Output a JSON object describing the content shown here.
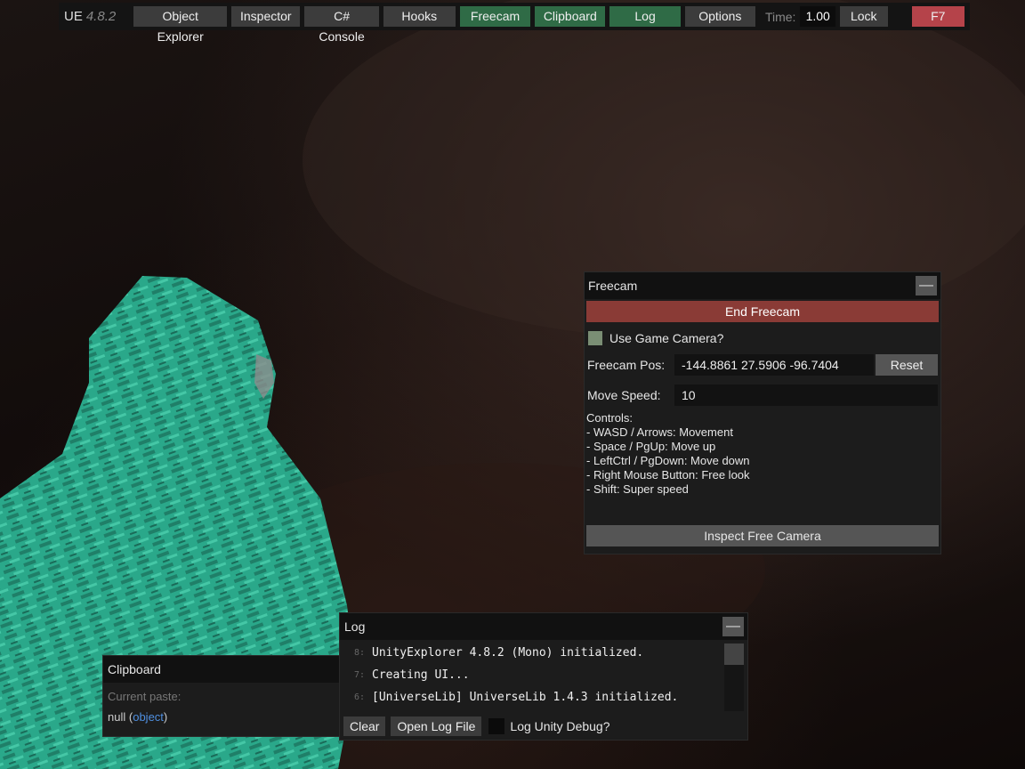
{
  "topbar": {
    "title": "UE",
    "version": "4.8.2",
    "buttons": [
      "Object Explorer",
      "Inspector",
      "C# Console",
      "Hooks",
      "Freecam",
      "Clipboard",
      "Log",
      "Options"
    ],
    "time_label": "Time:",
    "time_value": "1.00",
    "lock_label": "Lock",
    "hotkey_label": "F7"
  },
  "freecam": {
    "title": "Freecam",
    "minimize": "—",
    "end_label": "End Freecam",
    "use_game_camera_label": "Use Game Camera?",
    "pos_label": "Freecam Pos:",
    "pos_value": "-144.8861 27.5906 -96.7404",
    "reset_label": "Reset",
    "speed_label": "Move Speed:",
    "speed_value": "10",
    "controls": [
      "Controls:",
      "- WASD / Arrows: Movement",
      "- Space / PgUp: Move up",
      "- LeftCtrl / PgDown: Move down",
      "- Right Mouse Button: Free look",
      "- Shift: Super speed"
    ],
    "inspect_label": "Inspect Free Camera"
  },
  "log": {
    "title": "Log",
    "minimize": "—",
    "lines": [
      {
        "num": "8:",
        "text": "UnityExplorer 4.8.2 (Mono) initialized."
      },
      {
        "num": "7:",
        "text": "Creating UI..."
      },
      {
        "num": "6:",
        "text": "[UniverseLib] UniverseLib 1.4.3 initialized."
      }
    ],
    "clear_label": "Clear",
    "open_file_label": "Open Log File",
    "debug_label": "Log Unity Debug?"
  },
  "clipboard": {
    "title": "Clipboard",
    "current_paste_label": "Current paste:",
    "value_null": "null",
    "value_type": "object"
  },
  "colors": {
    "toggle_on": "#2f6b46",
    "danger": "#b5434a",
    "end_freecam": "#8a3b36",
    "link": "#4f8fe0",
    "character": "#2fa88c"
  }
}
